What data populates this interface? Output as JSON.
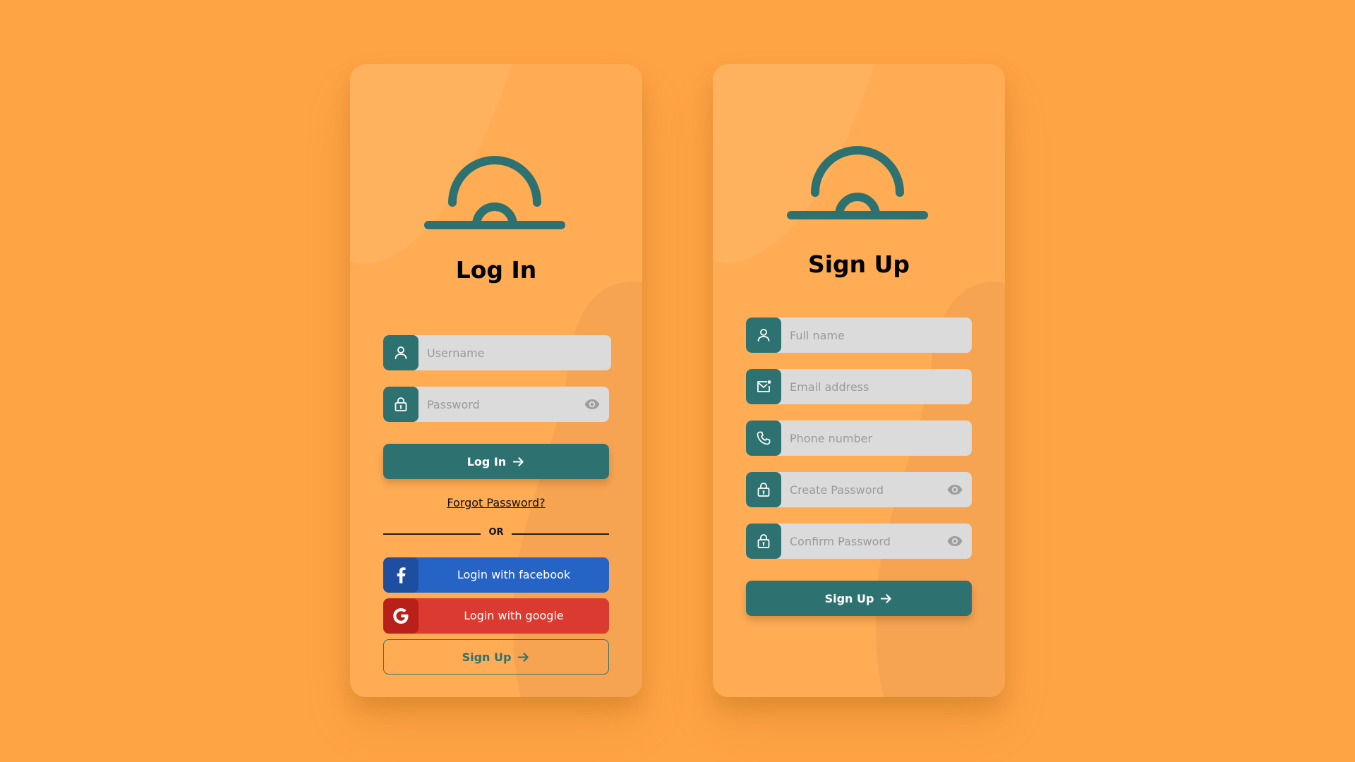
{
  "colors": {
    "background": "#FFA445",
    "card": "#FFAC55",
    "accent": "#2D7270",
    "field": "#DBDBDB",
    "facebook": "#2563C4",
    "google": "#DA3A30"
  },
  "login": {
    "title": "Log In",
    "username_placeholder": "Username",
    "password_placeholder": "Password",
    "submit_label": "Log In",
    "forgot_label": "Forgot Password?",
    "divider_label": "OR",
    "facebook_label": "Login with facebook",
    "google_label": "Login with google",
    "signup_label": "Sign Up",
    "icons": [
      "user-icon",
      "lock-icon",
      "eye-icon",
      "arrow-right-icon",
      "facebook-icon",
      "google-icon"
    ]
  },
  "signup": {
    "title": "Sign Up",
    "fullname_placeholder": "Full name",
    "email_placeholder": "Email address",
    "phone_placeholder": "Phone number",
    "create_password_placeholder": "Create Password",
    "confirm_password_placeholder": "Confirm Password",
    "submit_label": "Sign Up",
    "icons": [
      "user-icon",
      "mail-icon",
      "phone-icon",
      "lock-icon",
      "eye-icon",
      "arrow-right-icon"
    ]
  }
}
